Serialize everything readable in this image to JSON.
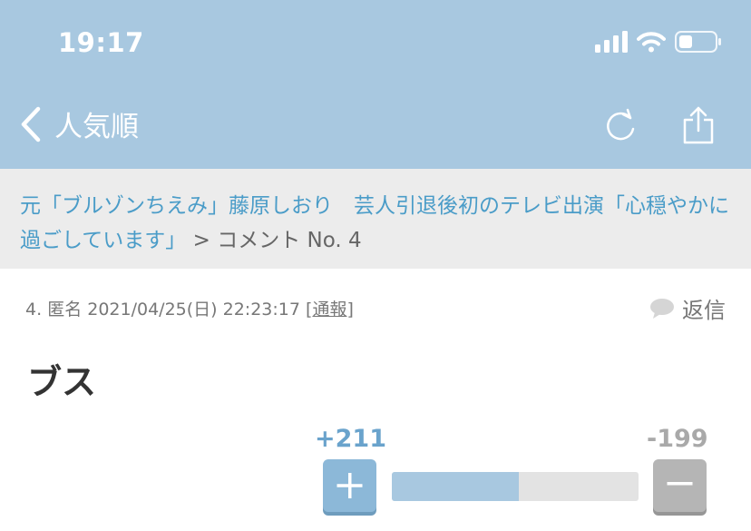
{
  "status_bar": {
    "time": "19:17"
  },
  "nav": {
    "back_label": "人気順"
  },
  "breadcrumb": {
    "article_title": "元「ブルゾンちえみ」藤原しおり　芸人引退後初のテレビ出演「心穏やかに過ごしています」",
    "separator": ">",
    "current": "コメント No. 4"
  },
  "comment": {
    "number": "4.",
    "author": "匿名",
    "datetime": "2021/04/25(日) 22:23:17",
    "report_open": "[",
    "report_label": "通報",
    "report_close": "]",
    "reply_label": "返信",
    "text": "ブス",
    "votes": {
      "plus_label": "+211",
      "minus_label": "-199",
      "plus_fraction": 0.515
    }
  },
  "colors": {
    "accent": "#a8c8e0",
    "link": "#4a9cc8",
    "plus": "#6aa3cc",
    "minus": "#a9a9a9"
  },
  "icons": [
    "signal-icon",
    "wifi-icon",
    "battery-icon",
    "chevron-left-icon",
    "refresh-icon",
    "share-icon",
    "speech-bubble-icon",
    "plus-icon",
    "minus-icon"
  ]
}
